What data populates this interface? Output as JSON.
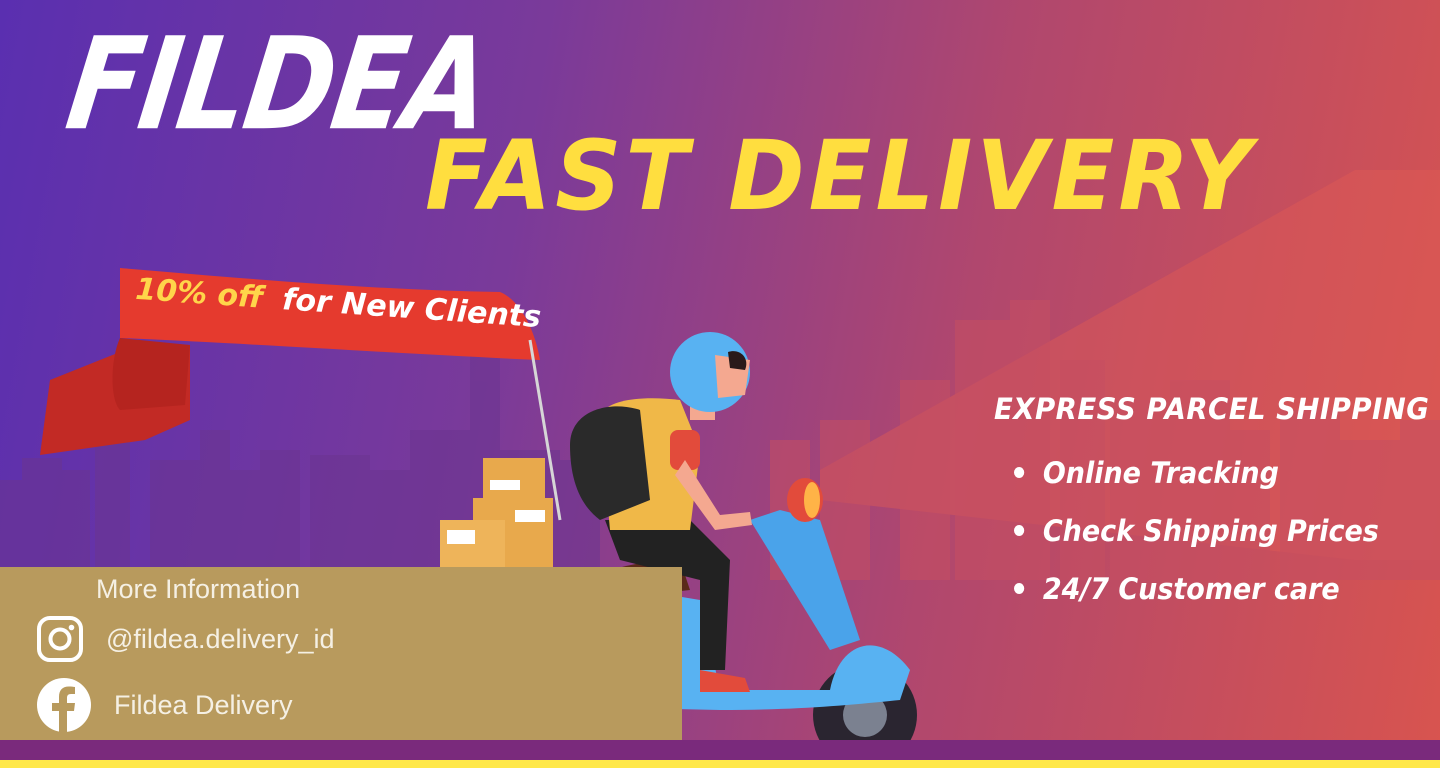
{
  "brand": {
    "name": "FILDEA"
  },
  "headline": "FAST DELIVERY",
  "promo": {
    "discount": "10% off",
    "audience": "for New Clients"
  },
  "features": {
    "title": "EXPRESS PARCEL SHIPPING",
    "items": [
      {
        "label": "Online Tracking"
      },
      {
        "label": "Check Shipping Prices"
      },
      {
        "label": "24/7 Customer care"
      }
    ]
  },
  "contact": {
    "title": "More Information",
    "instagram": {
      "icon": "instagram-icon",
      "handle": "@fildea.delivery_id"
    },
    "facebook": {
      "icon": "facebook-icon",
      "name": "Fildea Delivery"
    }
  },
  "colors": {
    "headline": "#ffde3f",
    "ribbon": "#e53a2e",
    "panel": "#b89a5d",
    "scooter": "#58b2f2"
  }
}
